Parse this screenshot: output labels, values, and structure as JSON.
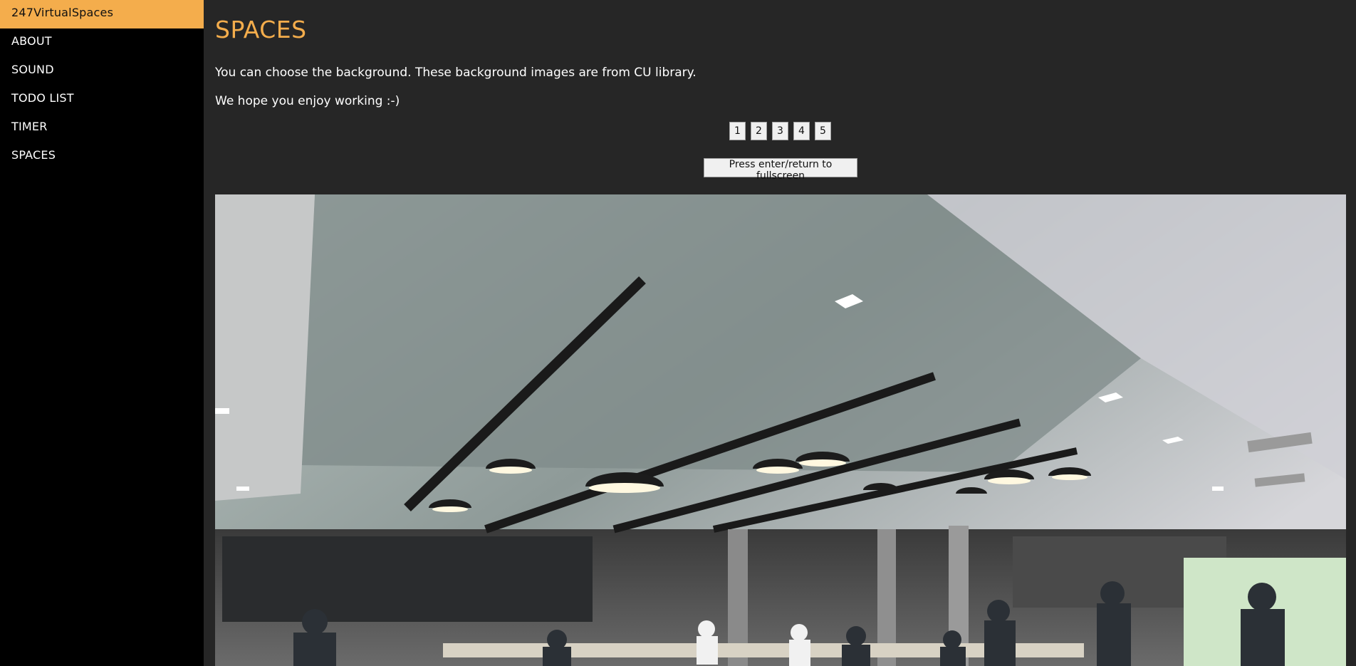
{
  "sidebar": {
    "brand": "247VirtualSpaces",
    "items": [
      {
        "label": "ABOUT"
      },
      {
        "label": "SOUND"
      },
      {
        "label": "TODO LIST"
      },
      {
        "label": "TIMER"
      },
      {
        "label": "SPACES"
      }
    ]
  },
  "main": {
    "title": "SPACES",
    "description": "You can choose the background. These background images are from CU library.",
    "greeting": "We hope you enjoy working :-)",
    "pages": [
      "1",
      "2",
      "3",
      "4",
      "5"
    ],
    "fullscreen_label": "Press enter/return to fullscreen",
    "image_icon": "library-photo"
  },
  "colors": {
    "accent": "#f4ad4c",
    "sidebar_bg": "#000000",
    "main_bg": "#262626"
  }
}
